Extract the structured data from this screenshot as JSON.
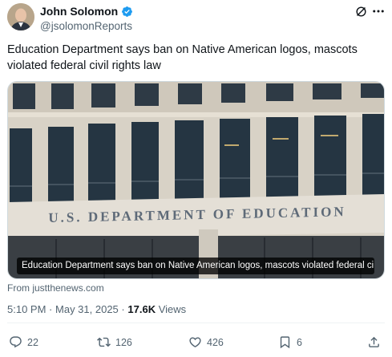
{
  "author": {
    "name": "John Solomon",
    "handle": "@jsolomonReports",
    "verified": true
  },
  "tweet": {
    "text": "Education Department says ban on Native American logos, mascots violated federal civil rights law"
  },
  "media": {
    "sign_text": "U.S. DEPARTMENT OF EDUCATION",
    "caption": "Education Department says ban on Native American logos, mascots violated federal ci..."
  },
  "source": "From justthenews.com",
  "meta": {
    "time": "5:10 PM",
    "date": "May 31, 2025",
    "separator": "·",
    "views_count": "17.6K",
    "views_label": "Views"
  },
  "actions": {
    "replies": "22",
    "reposts": "126",
    "likes": "426",
    "bookmarks": "6"
  },
  "colors": {
    "verified": "#1d9bf0",
    "secondary_text": "#536471"
  },
  "icons": [
    "grok-icon",
    "more-icon",
    "reply-icon",
    "repost-icon",
    "like-icon",
    "bookmark-icon",
    "share-icon"
  ]
}
